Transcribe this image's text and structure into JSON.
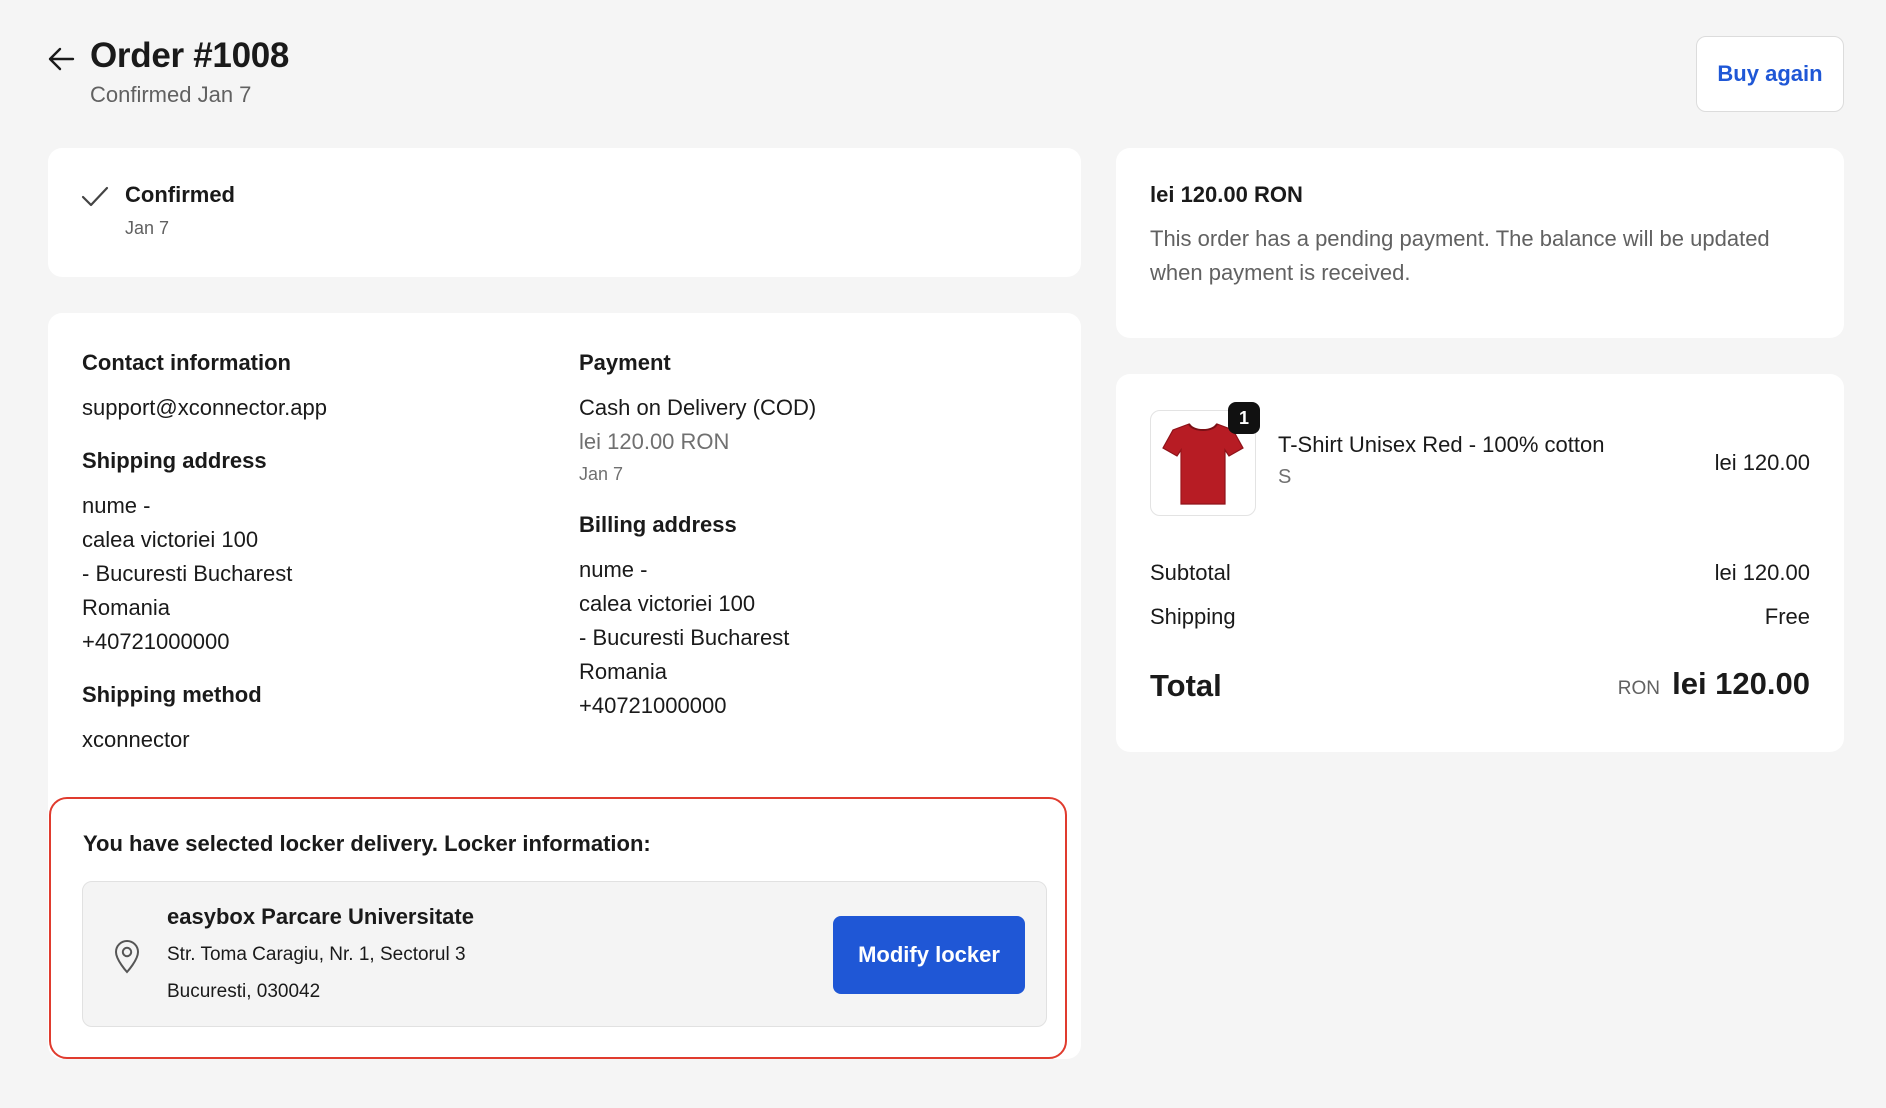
{
  "header": {
    "title": "Order #1008",
    "subtitle": "Confirmed Jan 7",
    "buy_again_label": "Buy again"
  },
  "status": {
    "title": "Confirmed",
    "date": "Jan 7"
  },
  "contact": {
    "title": "Contact information",
    "email": "support@xconnector.app"
  },
  "shipping_address": {
    "title": "Shipping address",
    "lines": [
      "nume -",
      "calea victoriei 100",
      "- Bucuresti Bucharest",
      "Romania",
      "+40721000000"
    ]
  },
  "shipping_method": {
    "title": "Shipping method",
    "value": "xconnector"
  },
  "payment": {
    "title": "Payment",
    "method": "Cash on Delivery (COD)",
    "amount": "lei 120.00 RON",
    "date": "Jan 7"
  },
  "billing_address": {
    "title": "Billing address",
    "lines": [
      "nume -",
      "calea victoriei 100",
      "- Bucuresti Bucharest",
      "Romania",
      "+40721000000"
    ]
  },
  "locker": {
    "heading": "You have selected locker delivery. Locker information:",
    "name": "easybox Parcare Universitate",
    "address_line1": "Str. Toma Caragiu, Nr. 1, Sectorul 3",
    "address_line2": "Bucuresti, 030042",
    "modify_label": "Modify locker",
    "icon": "map-pin-icon"
  },
  "payment_notice": {
    "amount": "lei 120.00 RON",
    "note": "This order has a pending payment. The balance will be updated when payment is received."
  },
  "summary": {
    "item": {
      "quantity": "1",
      "name": "T-Shirt Unisex Red - 100% cotton",
      "variant": "S",
      "price": "lei 120.00",
      "image": "red-tshirt-icon"
    },
    "subtotal_label": "Subtotal",
    "subtotal_value": "lei 120.00",
    "shipping_label": "Shipping",
    "shipping_value": "Free",
    "total_label": "Total",
    "total_currency": "RON",
    "total_value": "lei 120.00"
  },
  "colors": {
    "accent": "#1f57d6",
    "highlight_border": "#e03b2e",
    "background": "#f5f5f5"
  }
}
